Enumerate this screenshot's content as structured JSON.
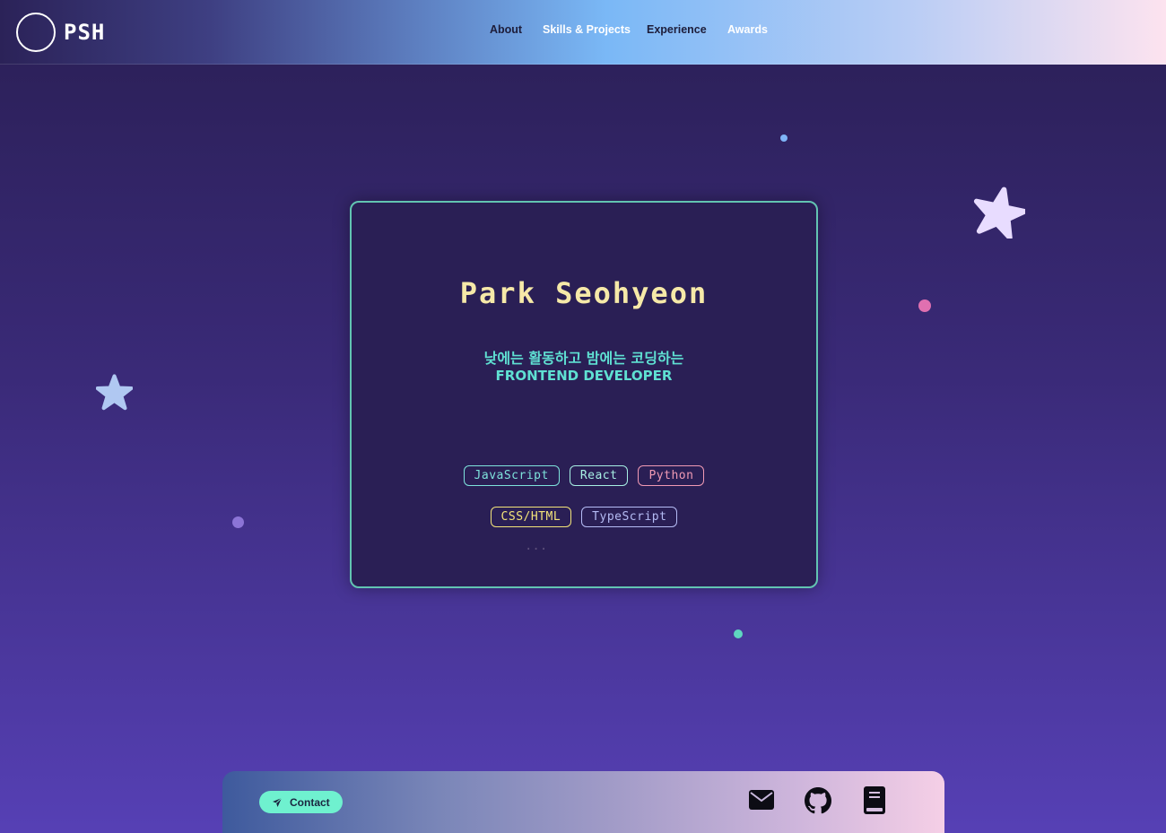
{
  "header": {
    "logo_text": "PSH",
    "nav": [
      "About",
      "Skills & Projects",
      "Experience",
      "Awards"
    ]
  },
  "hero": {
    "name": "Park Seohyeon",
    "subtitle_ko": "낮에는 활동하고 밤에는 코딩하는",
    "subtitle_en": "FRONTEND DEVELOPER",
    "tags_row1": [
      "JavaScript",
      "React",
      "Python"
    ],
    "tags_row2": [
      "CSS/HTML",
      "TypeScript"
    ],
    "more": "..."
  },
  "footer": {
    "contact_label": "Contact",
    "icons": [
      "mail-icon",
      "github-icon",
      "book-icon"
    ]
  },
  "colors": {
    "accent_teal": "#62c4b2",
    "title_yellow": "#f6e9a8",
    "subtitle_cyan": "#5fe0d2",
    "contact_button": "#6ff1cf"
  }
}
